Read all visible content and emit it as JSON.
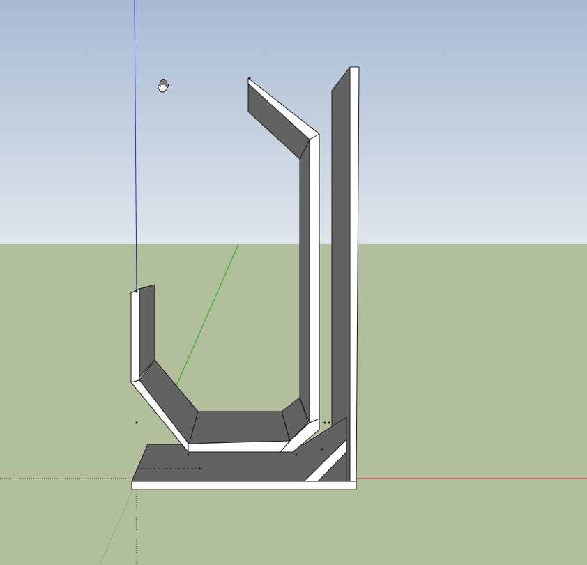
{
  "scene": {
    "sky_top_color": "#a8bad3",
    "sky_bottom_color": "#dfe5ec",
    "ground_color": "#b2bf9d",
    "face_color": "#ffffff",
    "shadow_color": "#626262",
    "edge_color": "#1a1a1a"
  },
  "axes": {
    "red_axis_color": "#cc1a1a",
    "green_axis_color": "#1fa21f",
    "blue_axis_color": "#2424c8"
  },
  "cursor": {
    "icon": "pan-hand-icon"
  }
}
